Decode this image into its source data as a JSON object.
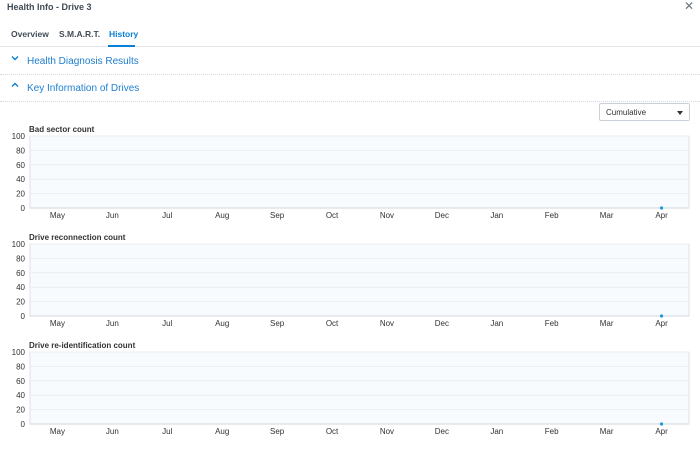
{
  "window": {
    "title": "Health Info - Drive 3"
  },
  "tabs": [
    {
      "label": "Overview"
    },
    {
      "label": "S.M.A.R.T."
    },
    {
      "label": "History"
    }
  ],
  "active_tab": "History",
  "sections": [
    {
      "label": "Health Diagnosis Results",
      "expanded": false,
      "icon": "chevron-down-icon"
    },
    {
      "label": "Key Information of Drives",
      "expanded": true,
      "icon": "chevron-up-icon"
    }
  ],
  "range_select": {
    "value": "Cumulative"
  },
  "colors": {
    "accent": "#0a7fd6",
    "point": "#1b9ad6",
    "grid": "#e9eef3",
    "plot_bg": "#f8fbfd"
  },
  "chart_data": [
    {
      "type": "scatter",
      "title": "Bad sector count",
      "categories": [
        "May",
        "Jun",
        "Jul",
        "Aug",
        "Sep",
        "Oct",
        "Nov",
        "Dec",
        "Jan",
        "Feb",
        "Mar",
        "Apr"
      ],
      "series": [
        {
          "x": [
            "Apr"
          ],
          "y": [
            0
          ]
        }
      ],
      "ylim": [
        0,
        100
      ],
      "yticks": [
        0,
        20,
        40,
        60,
        80,
        100
      ],
      "grid": true
    },
    {
      "type": "scatter",
      "title": "Drive reconnection count",
      "categories": [
        "May",
        "Jun",
        "Jul",
        "Aug",
        "Sep",
        "Oct",
        "Nov",
        "Dec",
        "Jan",
        "Feb",
        "Mar",
        "Apr"
      ],
      "series": [
        {
          "x": [
            "Apr"
          ],
          "y": [
            0
          ]
        }
      ],
      "ylim": [
        0,
        100
      ],
      "yticks": [
        0,
        20,
        40,
        60,
        80,
        100
      ],
      "grid": true
    },
    {
      "type": "scatter",
      "title": "Drive re-identification count",
      "categories": [
        "May",
        "Jun",
        "Jul",
        "Aug",
        "Sep",
        "Oct",
        "Nov",
        "Dec",
        "Jan",
        "Feb",
        "Mar",
        "Apr"
      ],
      "series": [
        {
          "x": [
            "Apr"
          ],
          "y": [
            0
          ]
        }
      ],
      "ylim": [
        0,
        100
      ],
      "yticks": [
        0,
        20,
        40,
        60,
        80,
        100
      ],
      "grid": true
    }
  ]
}
